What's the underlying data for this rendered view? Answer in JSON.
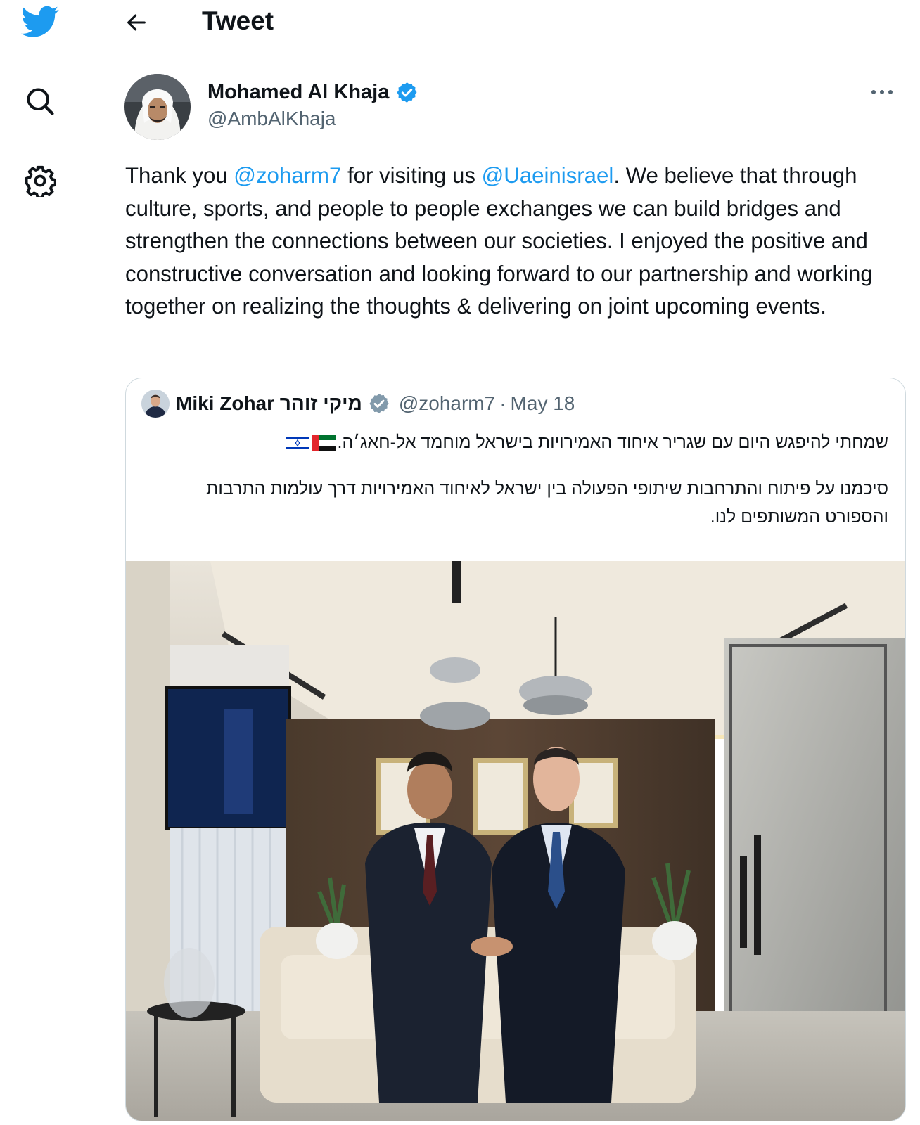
{
  "nav": {
    "logo": "twitter-bird-icon",
    "items": [
      {
        "icon": "search-icon"
      },
      {
        "icon": "settings-gear-icon"
      }
    ]
  },
  "header": {
    "title": "Tweet",
    "back_icon": "arrow-left-icon"
  },
  "tweet": {
    "author_name": "Mohamed Al Khaja",
    "author_handle": "@AmbAlKhaja",
    "text": {
      "part1": "Thank you ",
      "mention1": "@zoharm7",
      "part2": " for visiting us ",
      "mention2": "@Uaeinisrael",
      "part3": ". We believe that through culture, sports, and people to people exchanges we can build bridges and strengthen the connections between our societies. I enjoyed the positive and constructive conversation and looking forward to our partnership and working together on realizing the thoughts & delivering on joint upcoming events."
    }
  },
  "quote": {
    "author_name": "Miki Zohar מיקי זוהר",
    "author_handle": "@zoharm7",
    "separator": "·",
    "date": "May 18",
    "line1": "שמחתי להיפגש היום עם שגריר איחוד האמירויות בישראל מוחמד אל-חאג׳ה.",
    "line2": "סיכמנו על פיתוח והתרחבות שיתופי הפעולה בין ישראל לאיחוד האמירויות דרך עולמות התרבות והספורט המשותפים לנו."
  },
  "colors": {
    "brand": "#1d9bf0",
    "text": "#0f1419",
    "secondary": "#536471",
    "border": "#cfd9de",
    "verified_gray": "#829aab"
  }
}
